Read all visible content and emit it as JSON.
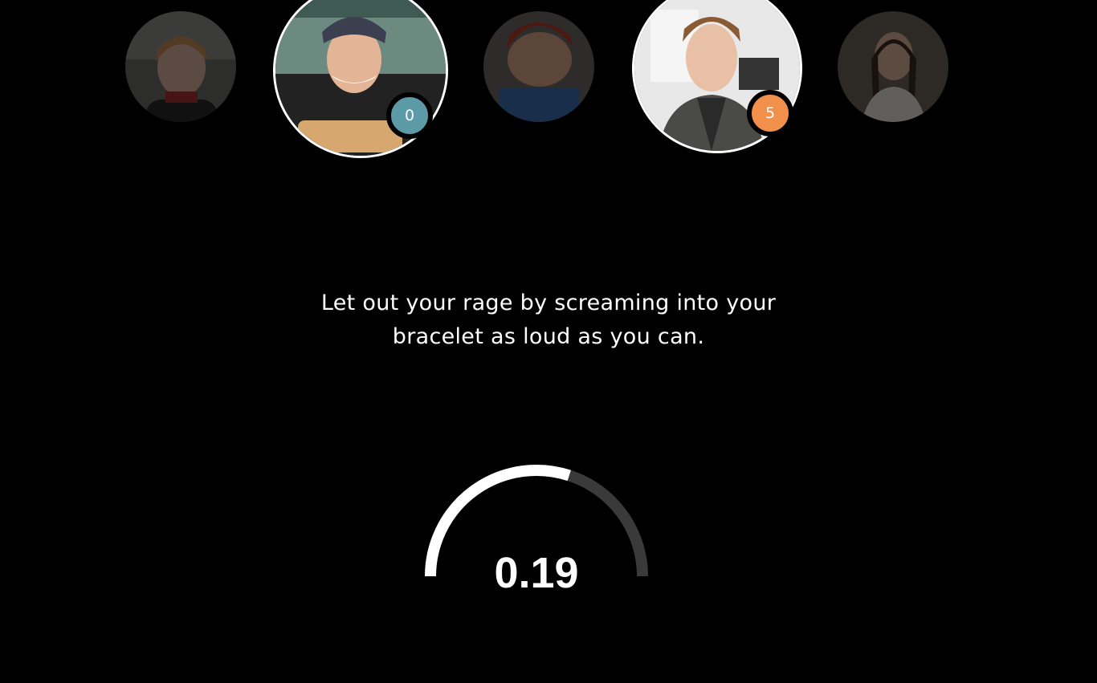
{
  "participants": [
    {
      "name_hint": "participant-1",
      "state": "dim"
    },
    {
      "name_hint": "participant-2",
      "state": "active",
      "score": "0",
      "badge_color": "#5b9aa6"
    },
    {
      "name_hint": "participant-3",
      "state": "dim"
    },
    {
      "name_hint": "participant-4",
      "state": "active",
      "score": "5",
      "badge_color": "#f0904a"
    },
    {
      "name_hint": "participant-5",
      "state": "dim"
    }
  ],
  "prompt": {
    "line1": "Let out your rage by screaming into your",
    "line2": "bracelet as loud as you can."
  },
  "meter": {
    "value_label": "0.19",
    "fill_fraction": 0.6,
    "track_color": "#3a3a3a",
    "fill_color": "#ffffff"
  }
}
